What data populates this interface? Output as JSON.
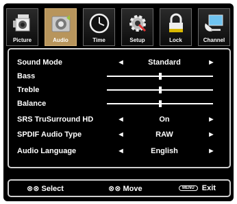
{
  "tabs": [
    {
      "label": "Picture",
      "icon": "camcorder-icon",
      "active": false
    },
    {
      "label": "Audio",
      "icon": "speaker-icon",
      "active": true
    },
    {
      "label": "Time",
      "icon": "clock-icon",
      "active": false
    },
    {
      "label": "Setup",
      "icon": "gear-icon",
      "active": false
    },
    {
      "label": "Lock",
      "icon": "lock-icon",
      "active": false
    },
    {
      "label": "Channel",
      "icon": "satellite-dish-icon",
      "active": false
    }
  ],
  "menu": {
    "sound_mode": {
      "label": "Sound  Mode",
      "value": "Standard",
      "arrow_left": "◄",
      "arrow_right": "►"
    },
    "bass": {
      "label": "Bass",
      "level": 0.5
    },
    "treble": {
      "label": "Treble",
      "level": 0.5
    },
    "balance": {
      "label": "Balance",
      "level": 0.5
    },
    "srs": {
      "label": "SRS TruSurround HD",
      "value": "On",
      "arrow_left": "◄",
      "arrow_right": "►"
    },
    "spdif": {
      "label": "SPDIF Audio Type",
      "value": "RAW",
      "arrow_left": "◄",
      "arrow_right": "►"
    },
    "language": {
      "label": "Audio  Language",
      "value": "English",
      "arrow_left": "◄",
      "arrow_right": "►"
    }
  },
  "footer": {
    "select_glyph": "⊗⊗",
    "select_label": "Select",
    "move_glyph": "⊗⊗",
    "move_label": "Move",
    "menu_key": "MENU",
    "exit_label": "Exit"
  },
  "colors": {
    "background": "#000000",
    "active_tab": "#b8955c",
    "border": "#d0d0d0",
    "text": "#ffffff"
  }
}
